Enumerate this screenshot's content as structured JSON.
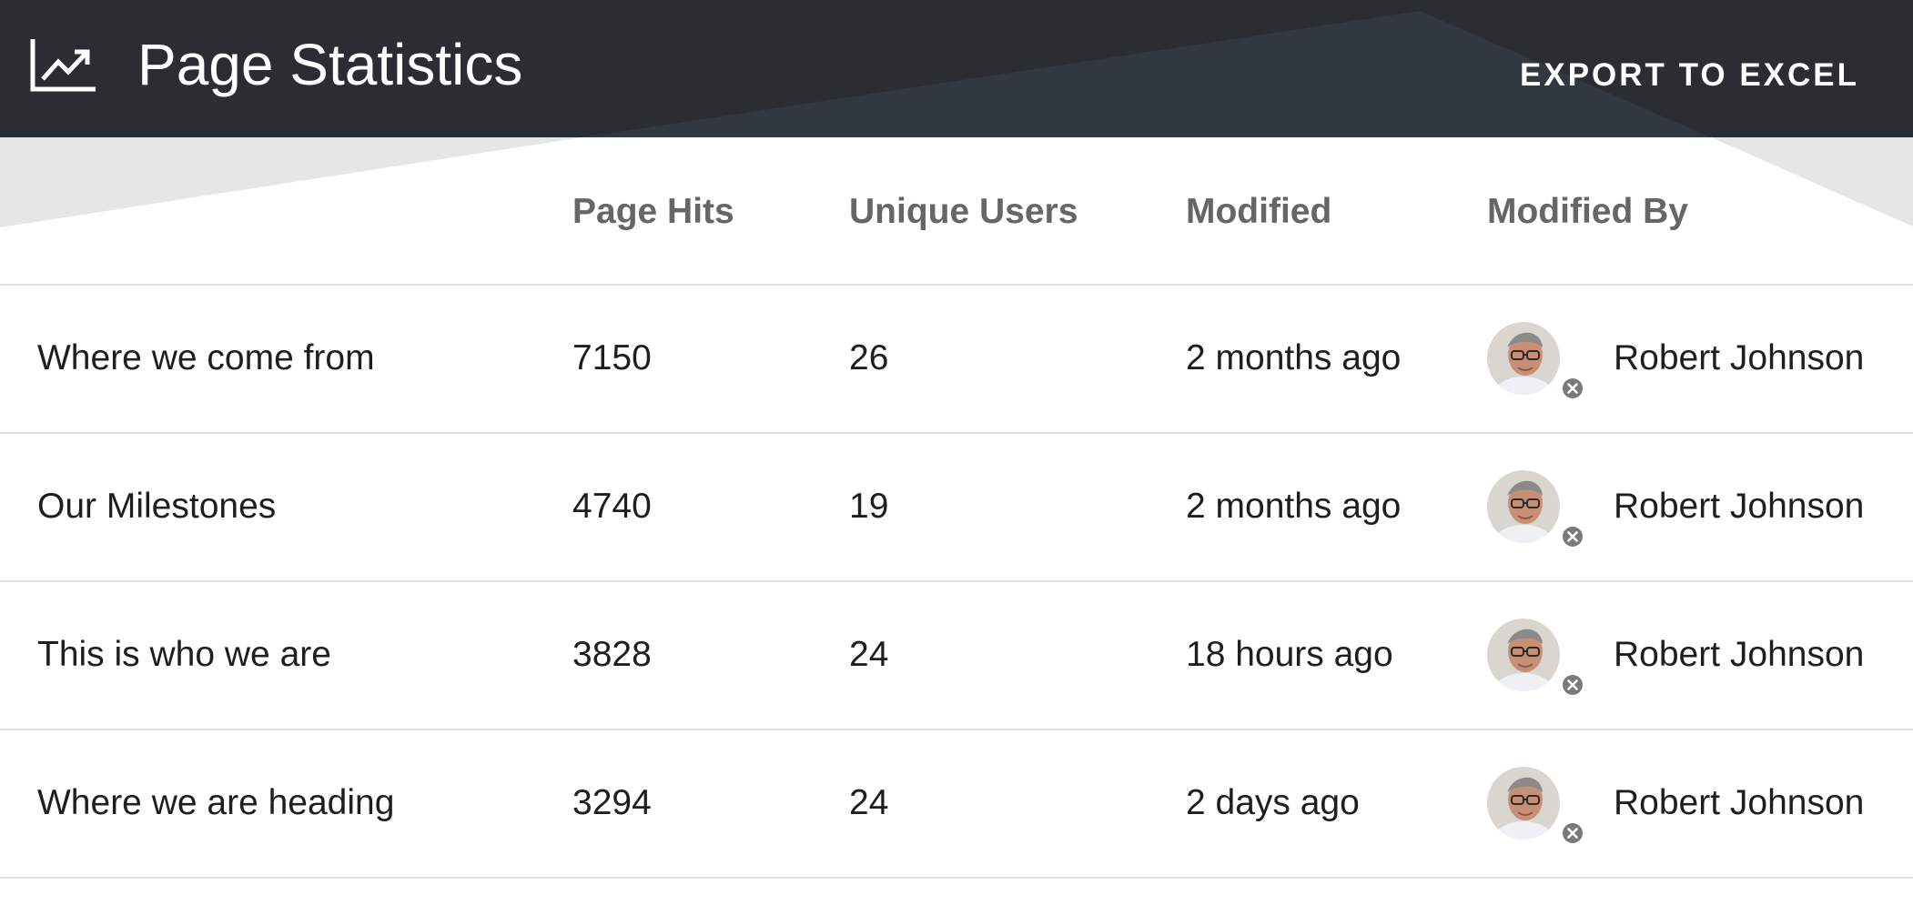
{
  "header": {
    "title": "Page Statistics",
    "export_label": "EXPORT TO EXCEL",
    "icon": "trending-up-chart-icon"
  },
  "table": {
    "columns": [
      "",
      "Page Hits",
      "Unique Users",
      "Modified",
      "Modified By"
    ],
    "rows": [
      {
        "page": "Where we come from",
        "hits": "7150",
        "users": "26",
        "modified": "2 months ago",
        "modified_by": "Robert Johnson"
      },
      {
        "page": "Our Milestones",
        "hits": "4740",
        "users": "19",
        "modified": "2 months ago",
        "modified_by": "Robert Johnson"
      },
      {
        "page": "This is who we are",
        "hits": "3828",
        "users": "24",
        "modified": "18 hours ago",
        "modified_by": "Robert Johnson"
      },
      {
        "page": "Where we are heading",
        "hits": "3294",
        "users": "24",
        "modified": "2 days ago",
        "modified_by": "Robert Johnson"
      }
    ]
  },
  "colors": {
    "header_bg": "#2a2e33",
    "header_text": "#ffffff",
    "column_header_text": "#666666",
    "presence_badge": "#7a7a7a"
  }
}
